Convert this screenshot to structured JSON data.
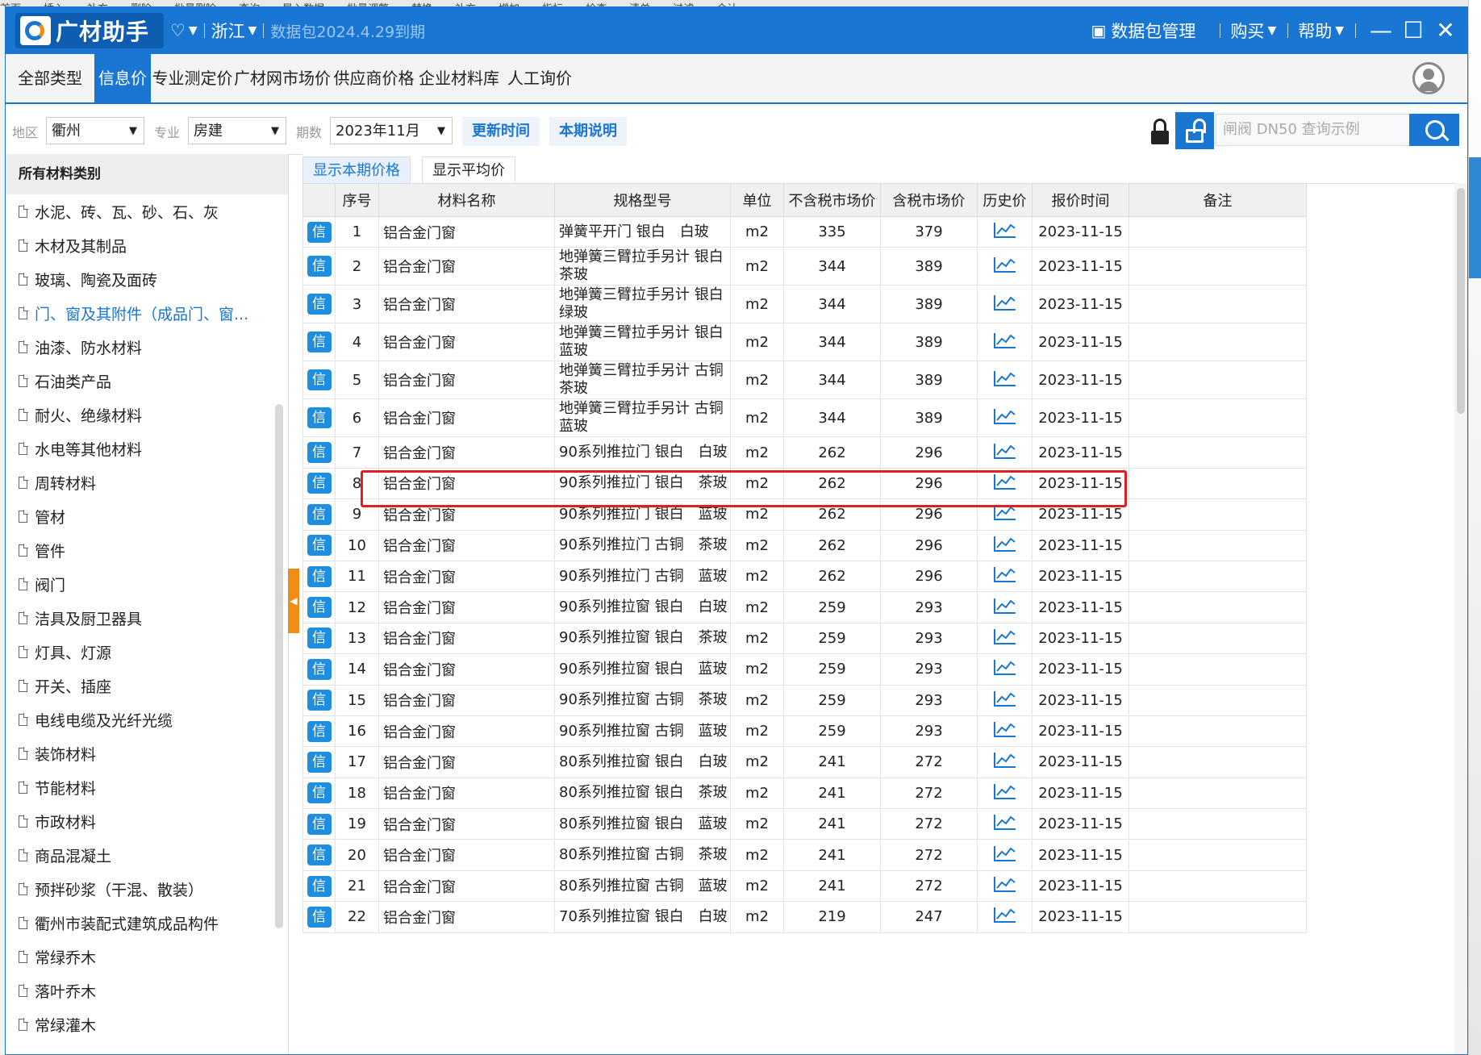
{
  "backstrip": [
    "首面",
    "插入",
    "补充",
    "删除",
    "批量删除",
    "查询",
    "导入数据",
    "批量调整",
    "替换",
    "补充",
    "增加",
    "指标",
    "检查",
    "清单",
    "过滤",
    "合计"
  ],
  "titlebar": {
    "app_name": "广材助手",
    "province": "浙江",
    "data_pack_status": "数据包2024.4.29到期",
    "data_pack_manage": "数据包管理",
    "buy": "购买",
    "help": "帮助",
    "minimize": "—",
    "maximize": "☐",
    "close": "✕"
  },
  "nav": {
    "tabs": [
      "全部类型",
      "信息价",
      "专业测定价",
      "广材网市场价",
      "供应商价格",
      "企业材料库",
      "人工询价"
    ],
    "active_index": 1
  },
  "filters": {
    "region_label": "地区",
    "region_value": "衢州",
    "specialty_label": "专业",
    "specialty_value": "房建",
    "period_label": "期数",
    "period_value": "2023年11月",
    "update_time_button": "更新时间",
    "period_note_button": "本期说明",
    "search_placeholder": "闸阀 DN50 查询示例"
  },
  "sidebar": {
    "header": "所有材料类别",
    "active_index": 3,
    "items": [
      "水泥、砖、瓦、砂、石、灰",
      "木材及其制品",
      "玻璃、陶瓷及面砖",
      "门、窗及其附件（成品门、窗...",
      "油漆、防水材料",
      "石油类产品",
      "耐火、绝缘材料",
      "水电等其他材料",
      "周转材料",
      "管材",
      "管件",
      "阀门",
      "洁具及厨卫器具",
      "灯具、灯源",
      "开关、插座",
      "电线电缆及光纤光缆",
      "装饰材料",
      "节能材料",
      "市政材料",
      "商品混凝土",
      "预拌砂浆（干混、散装）",
      "衢州市装配式建筑成品构件",
      "常绿乔木",
      "落叶乔木",
      "常绿灌木"
    ]
  },
  "subtabs": {
    "current": "显示本期价格",
    "average": "显示平均价"
  },
  "table": {
    "badge": "信",
    "columns": [
      "序号",
      "材料名称",
      "规格型号",
      "单位",
      "不含税市场价",
      "含税市场价",
      "历史价",
      "报价时间",
      "备注"
    ],
    "rows": [
      {
        "no": "1",
        "name": "铝合金门窗",
        "spec": "弹簧平开门 银白　白玻",
        "unit": "m2",
        "price_ex": "335",
        "price_in": "379",
        "date": "2023-11-15",
        "note": ""
      },
      {
        "no": "2",
        "name": "铝合金门窗",
        "spec": "地弹簧三臂拉手另计 银白 茶玻",
        "unit": "m2",
        "price_ex": "344",
        "price_in": "389",
        "date": "2023-11-15",
        "note": ""
      },
      {
        "no": "3",
        "name": "铝合金门窗",
        "spec": "地弹簧三臂拉手另计 银白 绿玻",
        "unit": "m2",
        "price_ex": "344",
        "price_in": "389",
        "date": "2023-11-15",
        "note": ""
      },
      {
        "no": "4",
        "name": "铝合金门窗",
        "spec": "地弹簧三臂拉手另计 银白 蓝玻",
        "unit": "m2",
        "price_ex": "344",
        "price_in": "389",
        "date": "2023-11-15",
        "note": ""
      },
      {
        "no": "5",
        "name": "铝合金门窗",
        "spec": "地弹簧三臂拉手另计 古铜 茶玻",
        "unit": "m2",
        "price_ex": "344",
        "price_in": "389",
        "date": "2023-11-15",
        "note": ""
      },
      {
        "no": "6",
        "name": "铝合金门窗",
        "spec": "地弹簧三臂拉手另计 古铜 蓝玻",
        "unit": "m2",
        "price_ex": "344",
        "price_in": "389",
        "date": "2023-11-15",
        "note": ""
      },
      {
        "no": "7",
        "name": "铝合金门窗",
        "spec": "90系列推拉门 银白　白玻",
        "unit": "m2",
        "price_ex": "262",
        "price_in": "296",
        "date": "2023-11-15",
        "note": ""
      },
      {
        "no": "8",
        "name": "铝合金门窗",
        "spec": "90系列推拉门 银白　茶玻",
        "unit": "m2",
        "price_ex": "262",
        "price_in": "296",
        "date": "2023-11-15",
        "note": ""
      },
      {
        "no": "9",
        "name": "铝合金门窗",
        "spec": "90系列推拉门 银白　蓝玻",
        "unit": "m2",
        "price_ex": "262",
        "price_in": "296",
        "date": "2023-11-15",
        "note": ""
      },
      {
        "no": "10",
        "name": "铝合金门窗",
        "spec": "90系列推拉门 古铜　茶玻",
        "unit": "m2",
        "price_ex": "262",
        "price_in": "296",
        "date": "2023-11-15",
        "note": ""
      },
      {
        "no": "11",
        "name": "铝合金门窗",
        "spec": "90系列推拉门 古铜　蓝玻",
        "unit": "m2",
        "price_ex": "262",
        "price_in": "296",
        "date": "2023-11-15",
        "note": ""
      },
      {
        "no": "12",
        "name": "铝合金门窗",
        "spec": "90系列推拉窗 银白　白玻",
        "unit": "m2",
        "price_ex": "259",
        "price_in": "293",
        "date": "2023-11-15",
        "note": ""
      },
      {
        "no": "13",
        "name": "铝合金门窗",
        "spec": "90系列推拉窗 银白　茶玻",
        "unit": "m2",
        "price_ex": "259",
        "price_in": "293",
        "date": "2023-11-15",
        "note": ""
      },
      {
        "no": "14",
        "name": "铝合金门窗",
        "spec": "90系列推拉窗 银白　蓝玻",
        "unit": "m2",
        "price_ex": "259",
        "price_in": "293",
        "date": "2023-11-15",
        "note": ""
      },
      {
        "no": "15",
        "name": "铝合金门窗",
        "spec": "90系列推拉窗 古铜　茶玻",
        "unit": "m2",
        "price_ex": "259",
        "price_in": "293",
        "date": "2023-11-15",
        "note": ""
      },
      {
        "no": "16",
        "name": "铝合金门窗",
        "spec": "90系列推拉窗 古铜　蓝玻",
        "unit": "m2",
        "price_ex": "259",
        "price_in": "293",
        "date": "2023-11-15",
        "note": ""
      },
      {
        "no": "17",
        "name": "铝合金门窗",
        "spec": "80系列推拉窗 银白　白玻",
        "unit": "m2",
        "price_ex": "241",
        "price_in": "272",
        "date": "2023-11-15",
        "note": ""
      },
      {
        "no": "18",
        "name": "铝合金门窗",
        "spec": "80系列推拉窗 银白　茶玻",
        "unit": "m2",
        "price_ex": "241",
        "price_in": "272",
        "date": "2023-11-15",
        "note": ""
      },
      {
        "no": "19",
        "name": "铝合金门窗",
        "spec": "80系列推拉窗 银白　蓝玻",
        "unit": "m2",
        "price_ex": "241",
        "price_in": "272",
        "date": "2023-11-15",
        "note": ""
      },
      {
        "no": "20",
        "name": "铝合金门窗",
        "spec": "80系列推拉窗 古铜　茶玻",
        "unit": "m2",
        "price_ex": "241",
        "price_in": "272",
        "date": "2023-11-15",
        "note": ""
      },
      {
        "no": "21",
        "name": "铝合金门窗",
        "spec": "80系列推拉窗 古铜　蓝玻",
        "unit": "m2",
        "price_ex": "241",
        "price_in": "272",
        "date": "2023-11-15",
        "note": ""
      },
      {
        "no": "22",
        "name": "铝合金门窗",
        "spec": "70系列推拉窗 银白　白玻",
        "unit": "m2",
        "price_ex": "219",
        "price_in": "247",
        "date": "2023-11-15",
        "note": ""
      }
    ]
  },
  "colors": {
    "brand_blue": "#1976d2",
    "badge_blue": "#1e8ee0",
    "accent_orange": "#f28c18",
    "highlight_red": "#e02020"
  }
}
